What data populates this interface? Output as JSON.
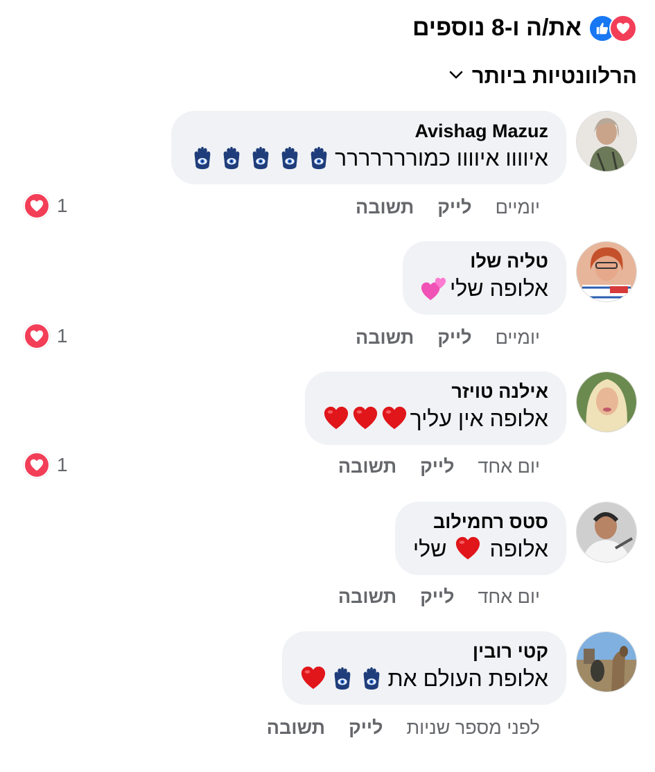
{
  "header": {
    "title": "את/ה ו-8 נוספים"
  },
  "sort": {
    "label": "הרלוונטיות ביותר"
  },
  "comments": [
    {
      "name": "Avishag Mazuz",
      "text": "איוווו איוווו כמוררררררר",
      "time": "יומיים",
      "like": "לייק",
      "reply": "תשובה",
      "reactions": "1"
    },
    {
      "name": "טליה שלו",
      "text": "אלופה שלי",
      "time": "יומיים",
      "like": "לייק",
      "reply": "תשובה",
      "reactions": "1"
    },
    {
      "name": "אילנה טויזר",
      "text": "אלופה אין עליך",
      "time": "יום אחד",
      "like": "לייק",
      "reply": "תשובה",
      "reactions": "1"
    },
    {
      "name": "סטס רחמילוב",
      "text_a": "אלופה",
      "text_b": "שלי",
      "time": "יום אחד",
      "like": "לייק",
      "reply": "תשובה"
    },
    {
      "name": "קטי רובין",
      "text": "אלופת העולם את",
      "time": "לפני מספר שניות",
      "like": "לייק",
      "reply": "תשובה"
    }
  ],
  "colors": {
    "heart": "#f33e58",
    "like": "#1877f2",
    "bubble": "#f0f2f5",
    "secondary": "#65676b"
  },
  "icons": [
    "heart-reaction-icon",
    "like-reaction-icon",
    "chevron-down-icon",
    "hamsa-emoji-icon",
    "red-heart-emoji-icon",
    "sparkling-hearts-emoji-icon"
  ]
}
